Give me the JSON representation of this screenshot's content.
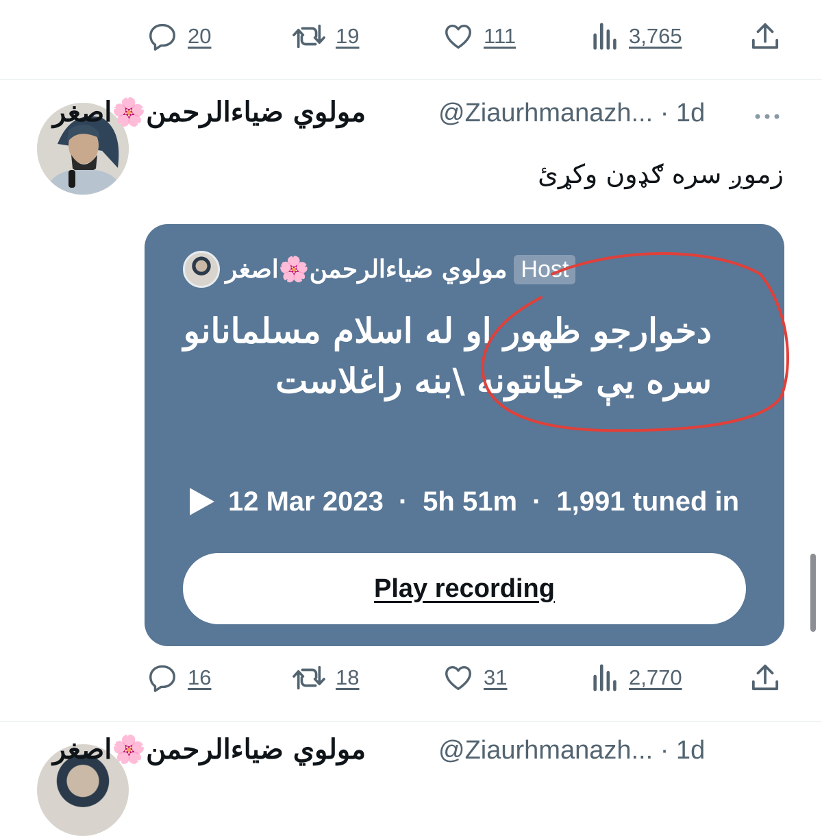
{
  "top_actions": {
    "replies": "20",
    "retweets": "19",
    "likes": "111",
    "views": "3,765"
  },
  "tweet": {
    "display_name": "مولوي ضياءالرحمن🌸اصغر",
    "handle": "@Ziaurhmanazh...",
    "time": "· 1d",
    "more_icon": "more-horizontal-icon",
    "text": "زموږ سره ګډون وکړئ",
    "space": {
      "host_name": "مولوي ضياءالرحمن🌸اصغر",
      "host_badge": "Host",
      "title": "دخوارجو ظهور او له اسلام مسلمانانو سره يې خيانتونه \\بنه راغلاست",
      "date": "12 Mar 2023",
      "duration": "5h 51m",
      "tuned_in": "1,991 tuned in",
      "separator": "·",
      "play_label": "Play recording",
      "card_color": "#597796"
    },
    "actions": {
      "replies": "16",
      "retweets": "18",
      "likes": "31",
      "views": "2,770"
    }
  },
  "next_tweet": {
    "display_name": "مولوي ضياءالرحمن🌸اصغر",
    "handle": "@Ziaurhmanazh...",
    "time": "· 1d"
  },
  "annotation_color": "#e0403a"
}
